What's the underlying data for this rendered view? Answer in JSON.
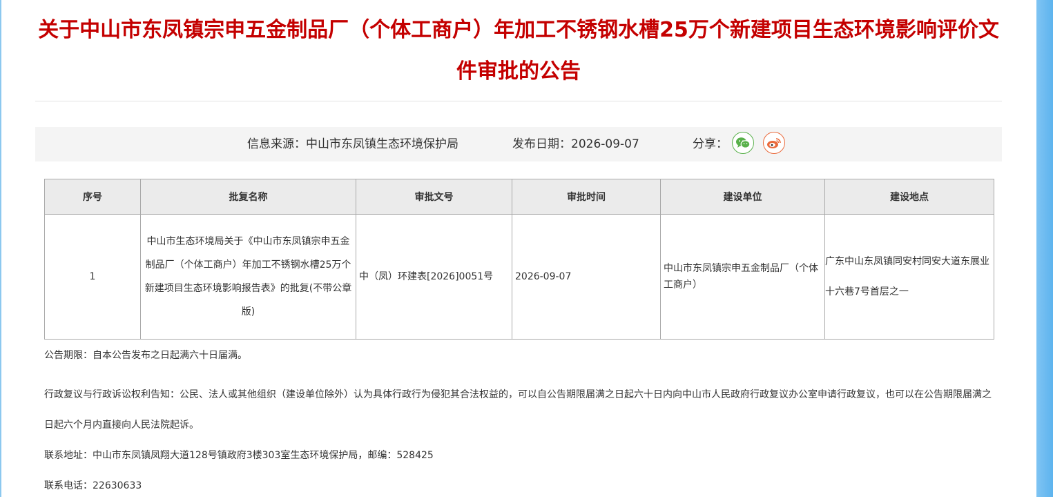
{
  "title": "关于中山市东凤镇宗申五金制品厂（个体工商户）年加工不锈钢水槽25万个新建项目生态环境影响评价文件审批的公告",
  "info": {
    "source_label": "信息来源：",
    "source": "中山市东凤镇生态环境保护局",
    "date_label": "发布日期：",
    "date": "2026-09-07",
    "share_label": "分享："
  },
  "share_icons": [
    "wechat-icon",
    "weibo-icon"
  ],
  "colors": {
    "title": "#c40000",
    "wechat": "#58b04a",
    "weibo": "#ea6a3c"
  },
  "table": {
    "headers": [
      "序号",
      "批复名称",
      "审批文号",
      "审批时间",
      "建设单位",
      "建设地点"
    ],
    "rows": [
      {
        "index": "1",
        "name": "中山市生态环境局关于《中山市东凤镇宗申五金制品厂（个体工商户）年加工不锈钢水槽25万个新建项目生态环境影响报告表》的批复(不带公章版)",
        "doc_no": "中（凤）环建表[2026]0051号",
        "approval_date": "2026-09-07",
        "unit": "中山市东凤镇宗申五金制品厂（个体工商户）",
        "location": "广东中山东凤镇同安村同安大道东展业十六巷7号首层之一"
      }
    ]
  },
  "notes": {
    "period": "公告期限：自本公告发布之日起满六十日届满。",
    "rights": "行政复议与行政诉讼权利告知：公民、法人或其他组织（建设单位除外）认为具体行政行为侵犯其合法权益的，可以自公告期限届满之日起六十日内向中山市人民政府行政复议办公室申请行政复议，也可以在公告期限届满之日起六个月内直接向人民法院起诉。",
    "address": "联系地址：中山市东凤镇凤翔大道128号镇政府3楼303室生态环境保护局，邮编：528425",
    "phone": "联系电话：22630633"
  }
}
